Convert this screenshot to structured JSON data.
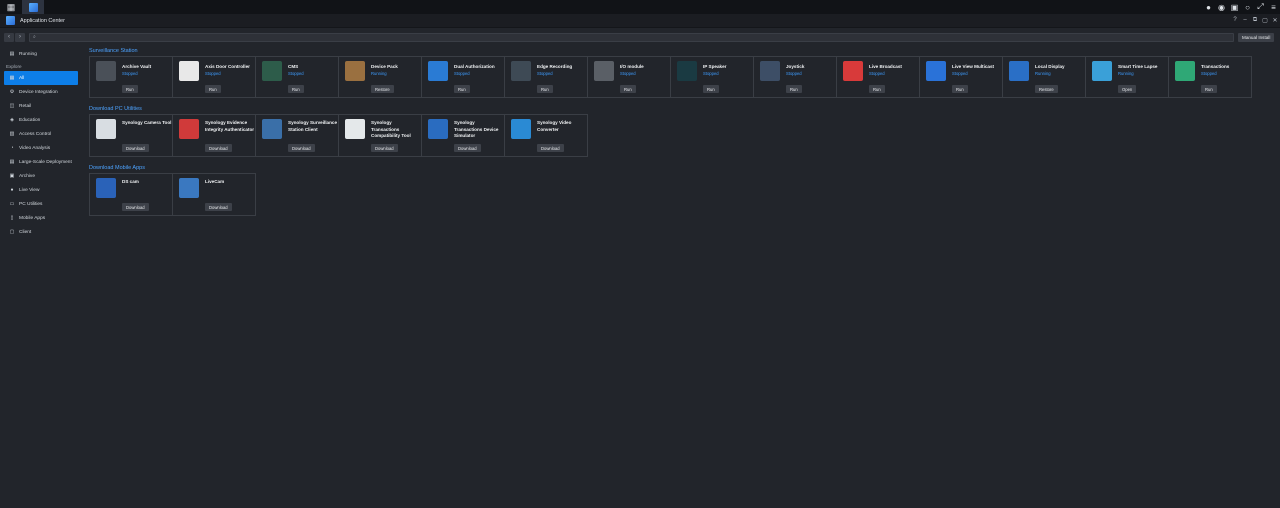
{
  "window": {
    "title": "Application Center"
  },
  "toolbar": {
    "search_placeholder": "",
    "manual_install_label": "Manual Install"
  },
  "sidebar": {
    "running_label": "Running",
    "explore_label": "Explore",
    "items": [
      {
        "label": "All",
        "icon": "grid-icon"
      },
      {
        "label": "Device Integration",
        "icon": "device-icon"
      },
      {
        "label": "Retail",
        "icon": "cart-icon"
      },
      {
        "label": "Education",
        "icon": "education-icon"
      },
      {
        "label": "Access Control",
        "icon": "lock-icon"
      },
      {
        "label": "Video Analysis",
        "icon": "analysis-icon"
      },
      {
        "label": "Large-Scale Deployment",
        "icon": "deployment-icon"
      },
      {
        "label": "Archive",
        "icon": "archive-icon"
      },
      {
        "label": "Live View",
        "icon": "live-view-icon"
      },
      {
        "label": "PC Utilities",
        "icon": "pc-icon"
      },
      {
        "label": "Mobile Apps",
        "icon": "mobile-icon"
      },
      {
        "label": "Client",
        "icon": "client-icon"
      }
    ]
  },
  "sections": [
    {
      "title": "Surveillance Station",
      "apps": [
        {
          "name": "Archive Vault",
          "status": "Stopped",
          "action": "Run",
          "color": "#4a5058",
          "icon": "archive-vault-icon"
        },
        {
          "name": "Axis Door Controller",
          "status": "Stopped",
          "action": "Run",
          "color": "#e8e8e8",
          "icon": "door-icon"
        },
        {
          "name": "CMS",
          "status": "Stopped",
          "action": "Run",
          "color": "#2d5c4a",
          "icon": "cms-icon"
        },
        {
          "name": "Device Pack",
          "status": "Running",
          "action": "Restore",
          "color": "#9a7040",
          "icon": "package-icon"
        },
        {
          "name": "Dual Authorization",
          "status": "Stopped",
          "action": "Run",
          "color": "#2a7bd4",
          "icon": "key-icon"
        },
        {
          "name": "Edge Recording",
          "status": "Stopped",
          "action": "Run",
          "color": "#3e4a55",
          "icon": "edge-recording-icon"
        },
        {
          "name": "I/O module",
          "status": "Stopped",
          "action": "Run",
          "color": "#5a5f66",
          "icon": "io-module-icon"
        },
        {
          "name": "IP Speaker",
          "status": "Stopped",
          "action": "Run",
          "color": "#1a3a42",
          "icon": "speaker-icon"
        },
        {
          "name": "Joystick",
          "status": "Stopped",
          "action": "Run",
          "color": "#3d4e66",
          "icon": "joystick-icon"
        },
        {
          "name": "Live Broadcast",
          "status": "Stopped",
          "action": "Run",
          "color": "#d83a3a",
          "icon": "live-broadcast-icon"
        },
        {
          "name": "Live View Multicast",
          "status": "Stopped",
          "action": "Run",
          "color": "#2a72d8",
          "icon": "multicast-icon"
        },
        {
          "name": "Local Display",
          "status": "Running",
          "action": "Restore",
          "color": "#2a6fc6",
          "icon": "monitor-icon"
        },
        {
          "name": "Smart Time Lapse",
          "status": "Running",
          "action": "Open",
          "color": "#3aa0d8",
          "icon": "timelapse-icon"
        },
        {
          "name": "Transactions",
          "status": "Stopped",
          "action": "Run",
          "color": "#2fa876",
          "icon": "transactions-icon"
        }
      ]
    },
    {
      "title": "Download PC Utilities",
      "apps": [
        {
          "name": "Synology Camera Tool",
          "status": "",
          "action": "Download",
          "color": "#d8dde2",
          "icon": "camera-tool-icon"
        },
        {
          "name": "Synology Evidence Integrity Authenticator",
          "status": "",
          "action": "Download",
          "color": "#d03a3a",
          "icon": "check-shield-icon"
        },
        {
          "name": "Synology Surveillance Station Client",
          "status": "",
          "action": "Download",
          "color": "#3a6fa8",
          "icon": "ss-client-icon"
        },
        {
          "name": "Synology Transactions Compatibility Tool",
          "status": "",
          "action": "Download",
          "color": "#e4e8ea",
          "icon": "compatibility-icon"
        },
        {
          "name": "Synology Transactions Device Simulator",
          "status": "",
          "action": "Download",
          "color": "#2a6cc0",
          "icon": "simulator-icon"
        },
        {
          "name": "Synology Video Converter",
          "status": "",
          "action": "Download",
          "color": "#2a8ad4",
          "icon": "video-converter-icon"
        }
      ]
    },
    {
      "title": "Download Mobile Apps",
      "apps": [
        {
          "name": "DS cam",
          "status": "",
          "action": "Download",
          "color": "#2a62b8",
          "icon": "ds-cam-icon"
        },
        {
          "name": "LiveCam",
          "status": "",
          "action": "Download",
          "color": "#3a78c0",
          "icon": "livecam-icon"
        }
      ]
    }
  ]
}
